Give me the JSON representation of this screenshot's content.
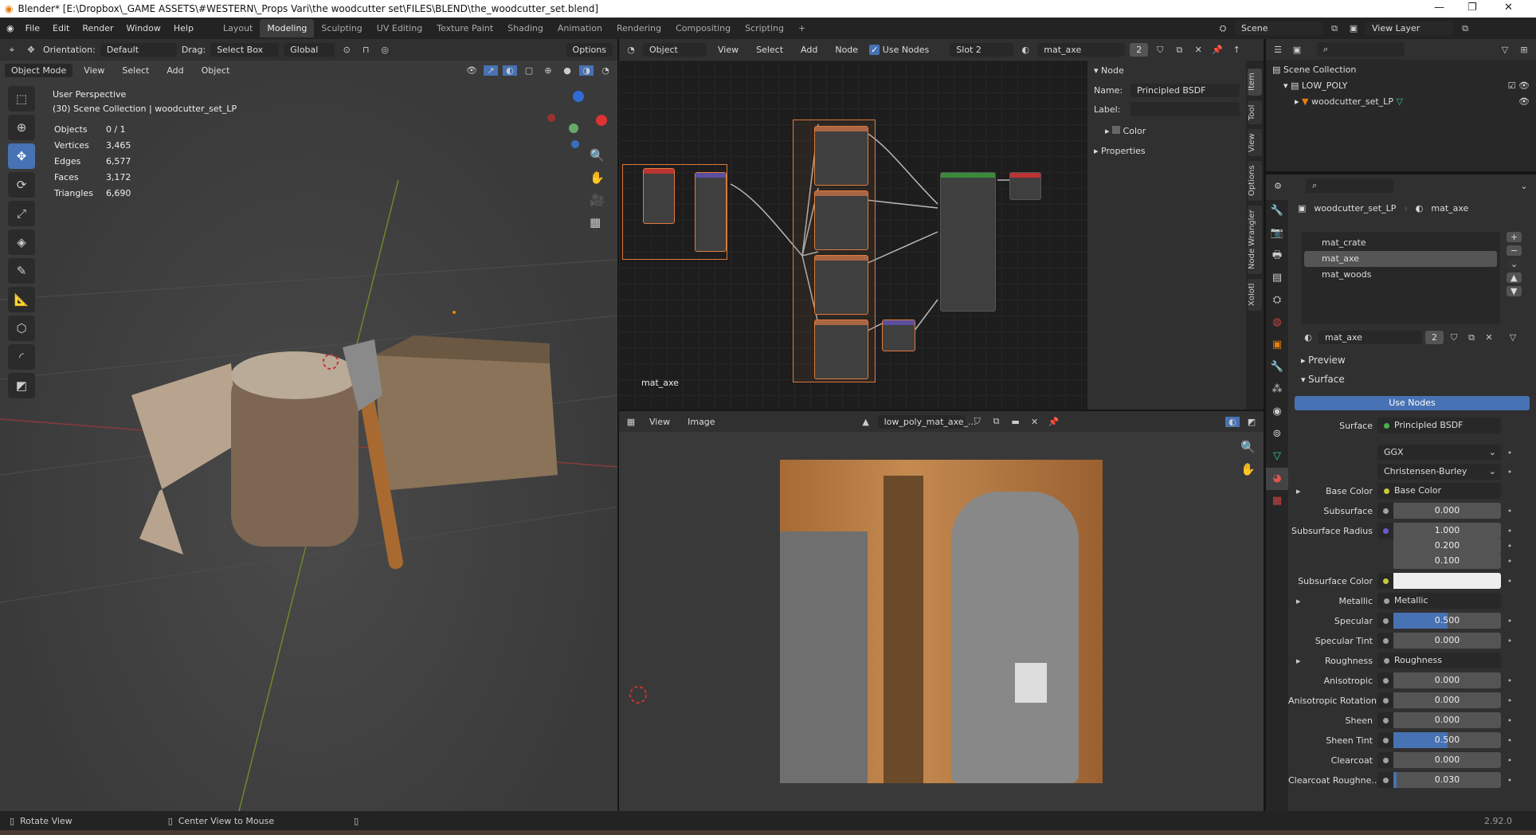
{
  "window": {
    "title": "Blender* [E:\\Dropbox\\_GAME ASSETS\\#WESTERN\\_Props Vari\\the woodcutter set\\FILES\\BLEND\\the_woodcutter_set.blend]"
  },
  "menu": [
    "File",
    "Edit",
    "Render",
    "Window",
    "Help"
  ],
  "workspaces": [
    "Layout",
    "Modeling",
    "Sculpting",
    "UV Editing",
    "Texture Paint",
    "Shading",
    "Animation",
    "Rendering",
    "Compositing",
    "Scripting"
  ],
  "active_workspace": "Modeling",
  "scene": {
    "scene": "Scene",
    "view_layer": "View Layer"
  },
  "viewport": {
    "header": {
      "orientation_label": "Orientation:",
      "orientation": "Default",
      "drag_label": "Drag:",
      "drag": "Select Box",
      "transform": "Global",
      "options": "Options"
    },
    "header2": {
      "mode": "Object Mode",
      "view": "View",
      "select": "Select",
      "add": "Add",
      "object": "Object"
    },
    "overlay": {
      "title": "User Perspective",
      "subtitle": "(30) Scene Collection | woodcutter_set_LP"
    },
    "stats": [
      {
        "k": "Objects",
        "v": "0 / 1"
      },
      {
        "k": "Vertices",
        "v": "3,465"
      },
      {
        "k": "Edges",
        "v": "6,577"
      },
      {
        "k": "Faces",
        "v": "3,172"
      },
      {
        "k": "Triangles",
        "v": "6,690"
      }
    ]
  },
  "node_editor": {
    "object": "Object",
    "view": "View",
    "select": "Select",
    "add": "Add",
    "node": "Node",
    "use_nodes": "Use Nodes",
    "slot": "Slot 2",
    "material": "mat_axe",
    "users": "2",
    "material_label": "mat_axe",
    "sidebar": {
      "panel": "Node",
      "name_label": "Name:",
      "name": "Principled BSDF",
      "label_label": "Label:",
      "label": "",
      "color": "Color",
      "properties": "Properties"
    },
    "tabs": [
      "Item",
      "Tool",
      "View",
      "Options",
      "Node Wrangler",
      "Xolotl"
    ]
  },
  "image_editor": {
    "view": "View",
    "image": "Image",
    "image_name": "low_poly_mat_axe_..."
  },
  "outliner": {
    "root": "Scene Collection",
    "collection": "LOW_POLY",
    "object": "woodcutter_set_LP"
  },
  "properties": {
    "breadcrumb": {
      "object": "woodcutter_set_LP",
      "material": "mat_axe"
    },
    "materials": [
      "mat_crate",
      "mat_axe",
      "mat_woods"
    ],
    "selected_material": "mat_axe",
    "material_name": "mat_axe",
    "users": "2",
    "preview": "Preview",
    "surface_panel": "Surface",
    "use_nodes": "Use Nodes",
    "surface_label": "Surface",
    "surface": "Principled BSDF",
    "distribution": "GGX",
    "subsurface_method": "Christensen-Burley",
    "rows": [
      {
        "label": "Base Color",
        "type": "link",
        "value": "Base Color",
        "dot": "#c8c83a",
        "expand": true
      },
      {
        "label": "Subsurface",
        "type": "num",
        "value": "0.000",
        "fill": 0
      },
      {
        "label": "Subsurface Radius",
        "type": "num",
        "value": "1.000",
        "fill": 0,
        "dot": "#6a5acd"
      },
      {
        "label": "",
        "type": "num",
        "value": "0.200",
        "fill": 0,
        "nodot": true
      },
      {
        "label": "",
        "type": "num",
        "value": "0.100",
        "fill": 0,
        "nodot": true
      },
      {
        "label": "Subsurface Color",
        "type": "color",
        "value": "",
        "dot": "#c8c83a"
      },
      {
        "label": "Metallic",
        "type": "link",
        "value": "Metallic",
        "expand": true
      },
      {
        "label": "Specular",
        "type": "num",
        "value": "0.500",
        "fill": 0.5
      },
      {
        "label": "Specular Tint",
        "type": "num",
        "value": "0.000",
        "fill": 0
      },
      {
        "label": "Roughness",
        "type": "link",
        "value": "Roughness",
        "expand": true
      },
      {
        "label": "Anisotropic",
        "type": "num",
        "value": "0.000",
        "fill": 0
      },
      {
        "label": "Anisotropic Rotation",
        "type": "num",
        "value": "0.000",
        "fill": 0
      },
      {
        "label": "Sheen",
        "type": "num",
        "value": "0.000",
        "fill": 0
      },
      {
        "label": "Sheen Tint",
        "type": "num",
        "value": "0.500",
        "fill": 0.5
      },
      {
        "label": "Clearcoat",
        "type": "num",
        "value": "0.000",
        "fill": 0
      },
      {
        "label": "Clearcoat Roughne...",
        "type": "num",
        "value": "0.030",
        "fill": 0.03
      }
    ]
  },
  "status": {
    "left": "Rotate View",
    "middle": "Center View to Mouse",
    "version": "2.92.0"
  }
}
